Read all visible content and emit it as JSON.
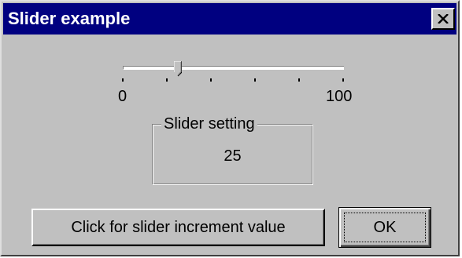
{
  "window": {
    "title": "Slider example"
  },
  "titlebar": {
    "close_icon": "close-x-icon",
    "active_color": "#000080"
  },
  "slider": {
    "min_label": "0",
    "max_label": "100",
    "min": 0,
    "max": 100,
    "value_fraction": 0.25,
    "tick_count": 11
  },
  "group": {
    "legend": "Slider setting",
    "value": "25"
  },
  "buttons": {
    "increment_label": "Click for slider increment value",
    "ok_label": "OK"
  }
}
